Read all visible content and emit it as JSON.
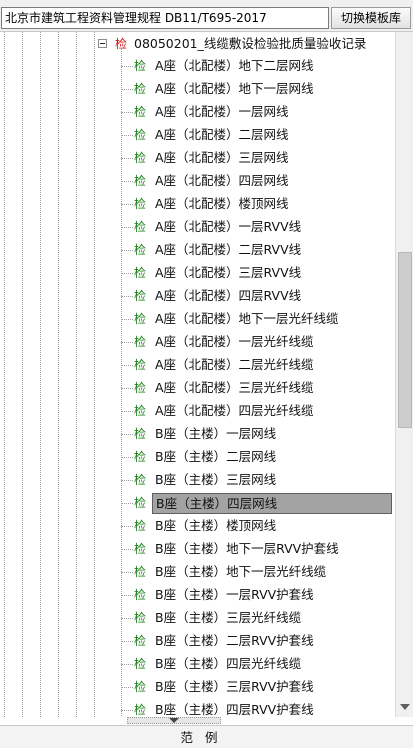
{
  "header": {
    "title_value": "北京市建筑工程资料管理规程 DB11/T695-2017",
    "switch_button_label": "切换模板库"
  },
  "tree": {
    "parent": {
      "icon_glyph": "检",
      "label": "08050201_线缆敷设检验批质量验收记录"
    },
    "item_icon_glyph": "检",
    "items": [
      {
        "label": "A座（北配楼）地下二层网线"
      },
      {
        "label": "A座（北配楼）地下一层网线"
      },
      {
        "label": "A座（北配楼）一层网线"
      },
      {
        "label": "A座（北配楼）二层网线"
      },
      {
        "label": "A座（北配楼）三层网线"
      },
      {
        "label": "A座（北配楼）四层网线"
      },
      {
        "label": "A座（北配楼）楼顶网线"
      },
      {
        "label": "A座（北配楼）一层RVV线"
      },
      {
        "label": "A座（北配楼）二层RVV线"
      },
      {
        "label": "A座（北配楼）三层RVV线"
      },
      {
        "label": "A座（北配楼）四层RVV线"
      },
      {
        "label": "A座（北配楼）地下一层光纤线缆"
      },
      {
        "label": "A座（北配楼）一层光纤线缆"
      },
      {
        "label": "A座（北配楼）二层光纤线缆"
      },
      {
        "label": "A座（北配楼）三层光纤线缆"
      },
      {
        "label": "A座（北配楼）四层光纤线缆"
      },
      {
        "label": "B座（主楼）一层网线"
      },
      {
        "label": "B座（主楼）二层网线"
      },
      {
        "label": "B座（主楼）三层网线"
      },
      {
        "label": "B座（主楼）四层网线",
        "selected": true
      },
      {
        "label": "B座（主楼）楼顶网线"
      },
      {
        "label": "B座（主楼）地下一层RVV护套线"
      },
      {
        "label": "B座（主楼）地下一层光纤线缆"
      },
      {
        "label": "B座（主楼）一层RVV护套线"
      },
      {
        "label": "B座（主楼）三层光纤线缆"
      },
      {
        "label": "B座（主楼）二层RVV护套线"
      },
      {
        "label": "B座（主楼）四层光纤线缆"
      },
      {
        "label": "B座（主楼）三层RVV护套线"
      },
      {
        "label": "B座（主楼）四层RVV护套线"
      }
    ]
  },
  "footer": {
    "legend_label": "范例"
  },
  "colors": {
    "parent_icon": "#cc1010",
    "item_icon": "#1a7f1a",
    "selection_bg": "#a3a3a3"
  }
}
